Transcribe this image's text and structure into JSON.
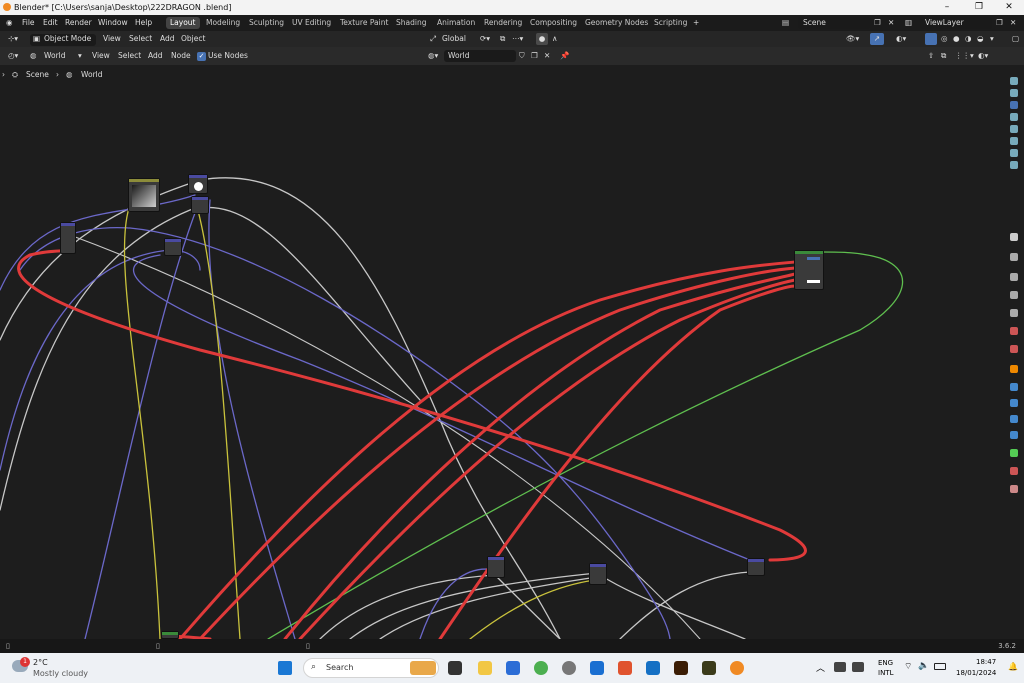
{
  "window": {
    "title": "Blender* [C:\\Users\\sanja\\Desktop\\222DRAGON .blend]"
  },
  "menu": {
    "items": [
      "File",
      "Edit",
      "Render",
      "Window",
      "Help"
    ]
  },
  "workspaces": {
    "tabs": [
      "Layout",
      "Modeling",
      "Sculpting",
      "UV Editing",
      "Texture Paint",
      "Shading",
      "Animation",
      "Rendering",
      "Compositing",
      "Geometry Nodes",
      "Scripting"
    ],
    "add_label": "+"
  },
  "scene": {
    "label": "Scene"
  },
  "view_layer": {
    "label": "ViewLayer"
  },
  "header": {
    "mode": "Object Mode",
    "view": "View",
    "select": "Select",
    "add": "Add",
    "object": "Object",
    "transform": "Global"
  },
  "node_header": {
    "type": "World",
    "view": "View",
    "select": "Select",
    "add": "Add",
    "node": "Node",
    "use_nodes_label": "Use Nodes",
    "use_nodes_checked": true,
    "world_field": "World"
  },
  "breadcrumb": {
    "scene": "Scene",
    "world": "World"
  },
  "status": {
    "version": "3.6.2"
  },
  "taskbar": {
    "weather_temp": "2°C",
    "weather_desc": "Mostly cloudy",
    "weather_badge": "1",
    "search_placeholder": "Search",
    "lang_top": "ENG",
    "lang_bottom": "INTL",
    "time": "18:47",
    "date": "18/01/2024"
  },
  "colors": {
    "link_red": "#e03a3a",
    "link_white": "#c7c7c7",
    "link_blue": "#6b68c9",
    "link_yellow": "#c9c23c",
    "link_green": "#5fbf4f",
    "accent": "#4772b3"
  }
}
